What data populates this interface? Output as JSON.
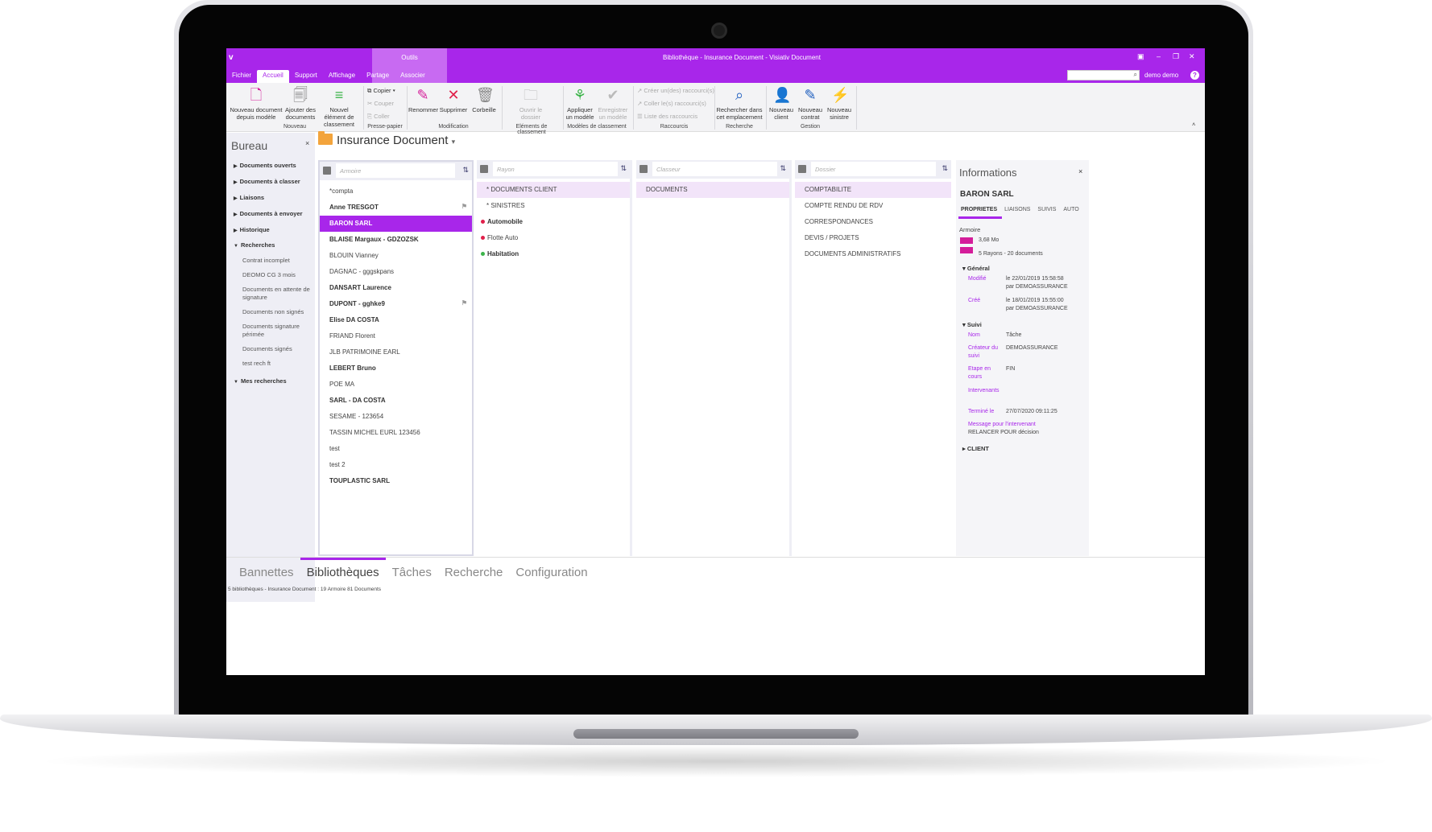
{
  "window": {
    "title": "Bibliothèque - Insurance Document - Visiativ Document",
    "logo": "v",
    "contextual_group": "Outils",
    "user": "demo demo",
    "help": "?"
  },
  "tabs": [
    "Fichier",
    "Accueil",
    "Support",
    "Affichage",
    "Partage",
    "Associer"
  ],
  "ribbon": {
    "new_doc": "Nouveau document depuis modèle",
    "add_docs": "Ajouter des documents",
    "new_item": "Nouvel élément de classement",
    "group_nouveau": "Nouveau",
    "copier": "Copier",
    "couper": "Couper",
    "coller": "Coller",
    "group_presse": "Presse-papier",
    "renommer": "Renommer",
    "supprimer": "Supprimer",
    "corbeille": "Corbeille",
    "group_modif": "Modification",
    "ouvrir_dossier": "Ouvrir le dossier",
    "group_elements": "Eléments de classement",
    "appliquer": "Appliquer un modèle",
    "enregistrer": "Enregistrer un modèle",
    "group_modeles": "Modèles de classement",
    "creer_raccourci": "Créer un(des) raccourci(s)",
    "coller_raccourci": "Coller le(s) raccourci(s)",
    "liste_raccourcis": "Liste des raccourcis",
    "group_raccourcis": "Raccourcis",
    "rechercher": "Rechercher dans cet emplacement",
    "group_recherche": "Recherche",
    "nouveau_client": "Nouveau client",
    "nouveau_contrat": "Nouveau contrat",
    "nouveau_sinistre": "Nouveau sinistre",
    "group_gestion": "Gestion"
  },
  "left": {
    "title": "Bureau",
    "close": "×",
    "nav": [
      "Documents ouverts",
      "Documents à classer",
      "Liaisons",
      "Documents à envoyer",
      "Historique",
      "Recherches"
    ],
    "searches": [
      "Contrat incomplet",
      "DEOMO CG 3 mois",
      "Documents en attente de signature",
      "Documents non signés",
      "Documents signature périmée",
      "Documents signés",
      "test rech ft"
    ],
    "mes_recherches": "Mes recherches"
  },
  "main": {
    "title": "Insurance Document",
    "filters": [
      "Armoire",
      "Rayon",
      "Classeur",
      "Dossier"
    ],
    "armoires": [
      "*compta",
      "Anne TRESGOT",
      "BARON SARL",
      "BLAISE Margaux - GDZOZSK",
      "BLOUIN Vianney",
      "DAGNAC - gggskpans",
      "DANSART Laurence",
      "DUPONT - gghke9",
      "Elise DA COSTA",
      "FRIAND Florent",
      "JLB PATRIMOINE EARL",
      "LEBERT Bruno",
      "POE MA",
      "SARL - DA COSTA",
      "SESAME - 123654",
      "TASSIN MICHEL EURL 123456",
      "test",
      "test 2",
      "TOUPLASTIC SARL"
    ],
    "rayons": [
      "* DOCUMENTS CLIENT",
      "* SINISTRES",
      "Automobile",
      "Flotte Auto",
      "Habitation"
    ],
    "classeurs": [
      "DOCUMENTS"
    ],
    "dossiers": [
      "COMPTABILITE",
      "COMPTE RENDU DE RDV",
      "CORRESPONDANCES",
      "DEVIS / PROJETS",
      "DOCUMENTS ADMINISTRATIFS"
    ],
    "colors": {
      "accent": "#a826ea",
      "red_dot": "#e0204a",
      "green_dot": "#3cb44a"
    }
  },
  "info": {
    "title": "Informations",
    "name": "BARON SARL",
    "tabs": [
      "PROPRIETES",
      "LIAISONS",
      "SUIVIS",
      "AUTO"
    ],
    "armoire": "Armoire",
    "size": "3,68 Mo",
    "count": "5 Rayons - 20 documents",
    "general": "Général",
    "modifie_label": "Modifié",
    "modifie_value": "le 22/01/2019 15:58:58",
    "modifie_by": "par DEMOASSURANCE",
    "cree_label": "Créé",
    "cree_value": "le 18/01/2019 15:55:00",
    "cree_by": "par DEMOASSURANCE",
    "suivi": "Suivi",
    "nom_label": "Nom",
    "nom_value": "Tâche",
    "createur_label": "Créateur du suivi",
    "createur_value": "DEMOASSURANCE",
    "etape_label": "Etape en cours",
    "etape_value": "FIN",
    "intervenants_label": "Intervenants",
    "termine_label": "Terminé le",
    "termine_value": "27/07/2020 09:11:25",
    "message_label": "Message pour l'intervenant",
    "message_value": "RELANCER POUR décision",
    "client": "CLIENT"
  },
  "bottom_tabs": [
    "Bannettes",
    "Bibliothèques",
    "Tâches",
    "Recherche",
    "Configuration"
  ],
  "status": "5 bibliothèques - Insurance Document : 19 Armoire 81 Documents"
}
